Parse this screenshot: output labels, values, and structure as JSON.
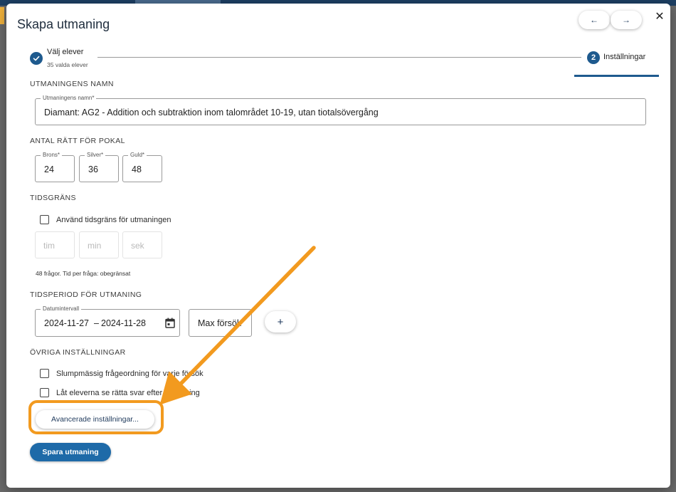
{
  "colors": {
    "primary": "#1e5a8e",
    "save_button": "#1e6aa8",
    "highlight": "#f29a1f",
    "backdrop": "#6b6b6b"
  },
  "dialog": {
    "title": "Skapa utmaning",
    "nav": {
      "prev_icon": "arrow-left-icon",
      "prev_glyph": "←",
      "next_icon": "arrow-right-icon",
      "next_glyph": "→"
    },
    "close_icon": "close-icon",
    "close_glyph": "✕"
  },
  "stepper": {
    "step1": {
      "icon": "check-icon",
      "title": "Välj elever",
      "subtitle": "35 valda elever"
    },
    "step2": {
      "number": "2",
      "title": "Inställningar"
    }
  },
  "name_section": {
    "heading": "UTMANINGENS NAMN",
    "field_label": "Utmaningens namn*",
    "value": "Diamant: AG2 - Addition och subtraktion inom talområdet 10-19, utan tiotalsövergång"
  },
  "trophy_section": {
    "heading": "ANTAL RÄTT FÖR POKAL",
    "fields": [
      {
        "label": "Brons*",
        "value": "24"
      },
      {
        "label": "Silver*",
        "value": "36"
      },
      {
        "label": "Guld*",
        "value": "48"
      }
    ]
  },
  "time_section": {
    "heading": "TIDSGRÄNS",
    "checkbox_label": "Använd tidsgräns för utmaningen",
    "checked": false,
    "fields": [
      {
        "placeholder": "tim"
      },
      {
        "placeholder": "min"
      },
      {
        "placeholder": "sek"
      }
    ],
    "note": "48 frågor. Tid per fråga: obegränsat"
  },
  "period_section": {
    "heading": "TIDSPERIOD FÖR UTMANING",
    "date_label": "Datumintervall",
    "start": "2024-11-27",
    "separator": "–",
    "end": "2024-11-28",
    "calendar_icon": "calendar-icon",
    "max_attempts": "Max försök",
    "add_glyph": "+"
  },
  "other_section": {
    "heading": "ÖVRIGA INSTÄLLNINGAR",
    "options": [
      {
        "label": "Slumpmässig frågeordning för varje försök",
        "checked": false
      },
      {
        "label": "Låt eleverna se rätta svar efter avslutning",
        "checked": false
      }
    ],
    "advanced_button": "Avancerade inställningar..."
  },
  "actions": {
    "save": "Spara utmaning"
  },
  "annotation": {
    "arrow_icon": "annotation-arrow-icon"
  }
}
